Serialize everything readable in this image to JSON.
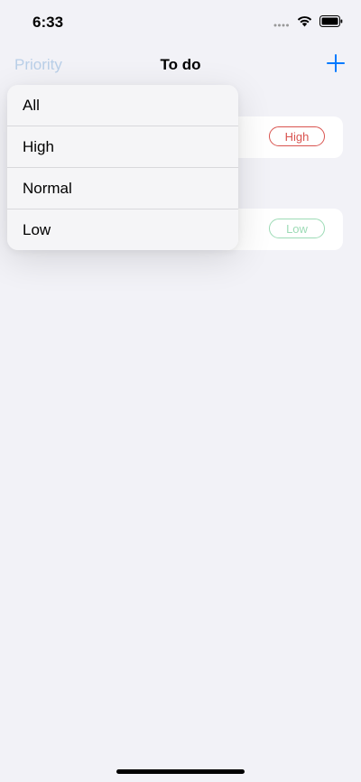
{
  "status_bar": {
    "time": "6:33"
  },
  "nav": {
    "left_label": "Priority",
    "title": "To do",
    "add_icon": "plus-icon"
  },
  "tasks": [
    {
      "name": "",
      "priority": "High"
    },
    {
      "name": "",
      "priority": "Low"
    }
  ],
  "priority_menu": {
    "items": [
      "All",
      "High",
      "Normal",
      "Low"
    ]
  },
  "colors": {
    "accent": "#007aff",
    "high": "#d9534f",
    "low": "#9ddbb6",
    "background": "#f2f2f7"
  }
}
